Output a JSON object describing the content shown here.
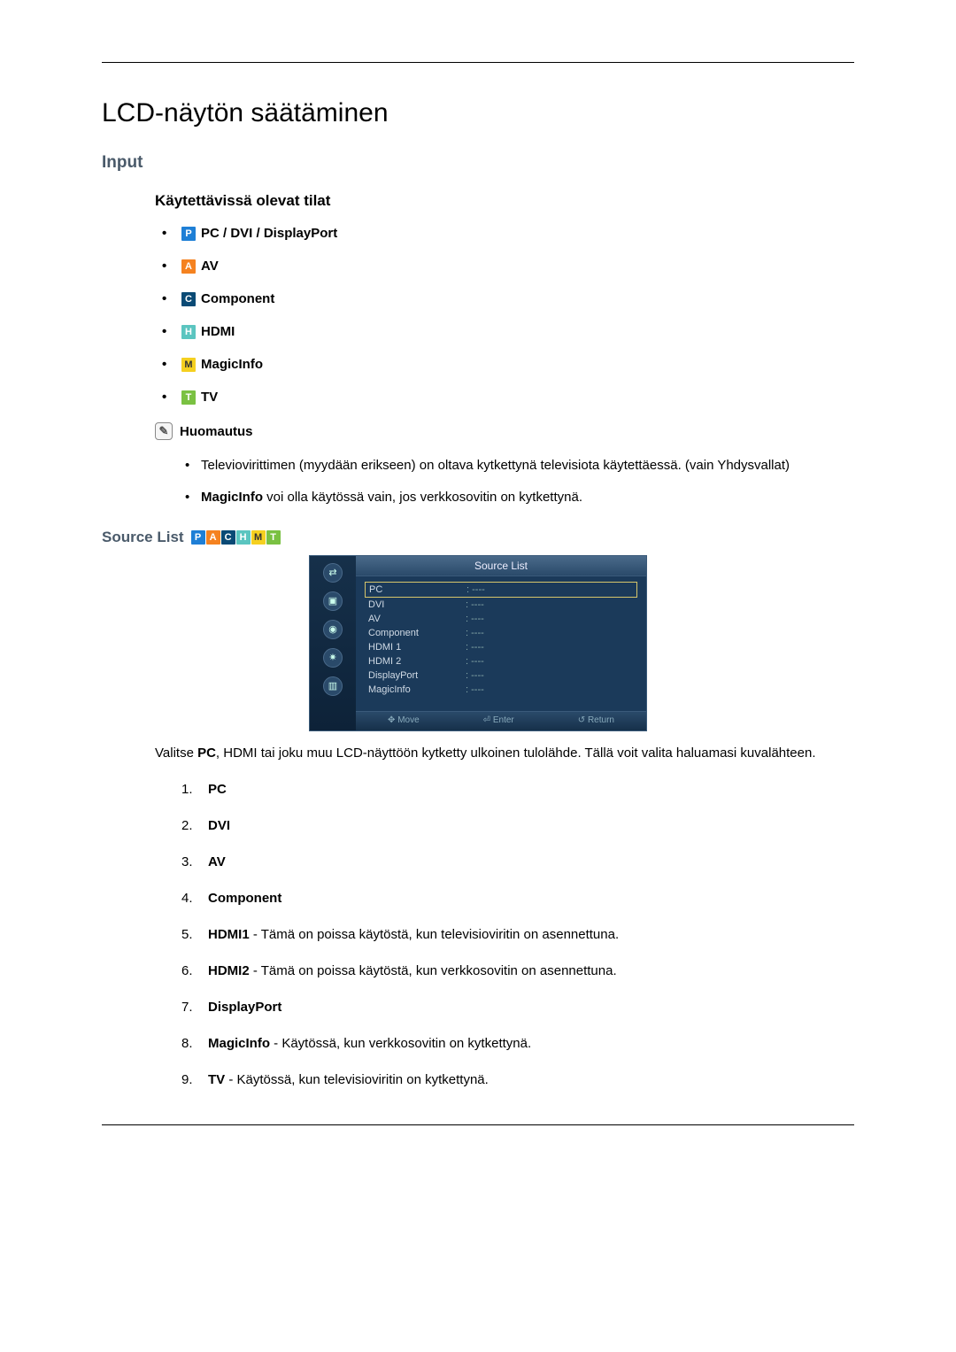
{
  "title": "LCD-näytön säätäminen",
  "section_input": "Input",
  "modes_heading": "Käytettävissä olevat tilat",
  "modes": [
    {
      "badge": "P",
      "label": "PC / DVI / DisplayPort"
    },
    {
      "badge": "A",
      "label": "AV"
    },
    {
      "badge": "C",
      "label": "Component"
    },
    {
      "badge": "H",
      "label": "HDMI"
    },
    {
      "badge": "M",
      "label": "MagicInfo"
    },
    {
      "badge": "T",
      "label": "TV"
    }
  ],
  "note_label": "Huomautus",
  "notes": {
    "n1": "Televiovirittimen (myydään erikseen) on oltava kytkettynä televisiota käytettäessä. (vain Yhdysvallat)",
    "n2_bold": "MagicInfo",
    "n2_rest": " voi olla käytössä vain, jos verkkosovitin on kytkettynä."
  },
  "source_list_label": "Source List",
  "osd": {
    "title": "Source List",
    "rows": [
      {
        "label": "PC",
        "val": ": ----",
        "sel": true
      },
      {
        "label": "DVI",
        "val": ": ----"
      },
      {
        "label": "AV",
        "val": ": ----"
      },
      {
        "label": "Component",
        "val": ": ----"
      },
      {
        "label": "HDMI 1",
        "val": ": ----"
      },
      {
        "label": "HDMI 2",
        "val": ": ----"
      },
      {
        "label": "DisplayPort",
        "val": ": ----"
      },
      {
        "label": "MagicInfo",
        "val": ": ----"
      }
    ],
    "footer": {
      "move": "Move",
      "enter": "Enter",
      "return": "Return"
    }
  },
  "desc_pre": "Valitse ",
  "desc_bold": "PC",
  "desc_post": ", HDMI tai joku muu LCD-näyttöön kytketty ulkoinen tulolähde. Tällä voit valita haluamasi kuvalähteen.",
  "ol": {
    "i1": "PC",
    "i2": "DVI",
    "i3": "AV",
    "i4": "Component",
    "i5_bold": "HDMI1",
    "i5_rest": " - Tämä on poissa käytöstä, kun televisioviritin on asennettuna.",
    "i6_bold": "HDMI2",
    "i6_rest": " - Tämä on poissa käytöstä, kun verkkosovitin on asennettuna.",
    "i7": "DisplayPort",
    "i8_bold": "MagicInfo",
    "i8_rest": " - Käytössä, kun verkkosovitin on kytkettynä.",
    "i9_bold": "TV",
    "i9_rest": " - Käytössä, kun televisioviritin on kytkettynä."
  }
}
